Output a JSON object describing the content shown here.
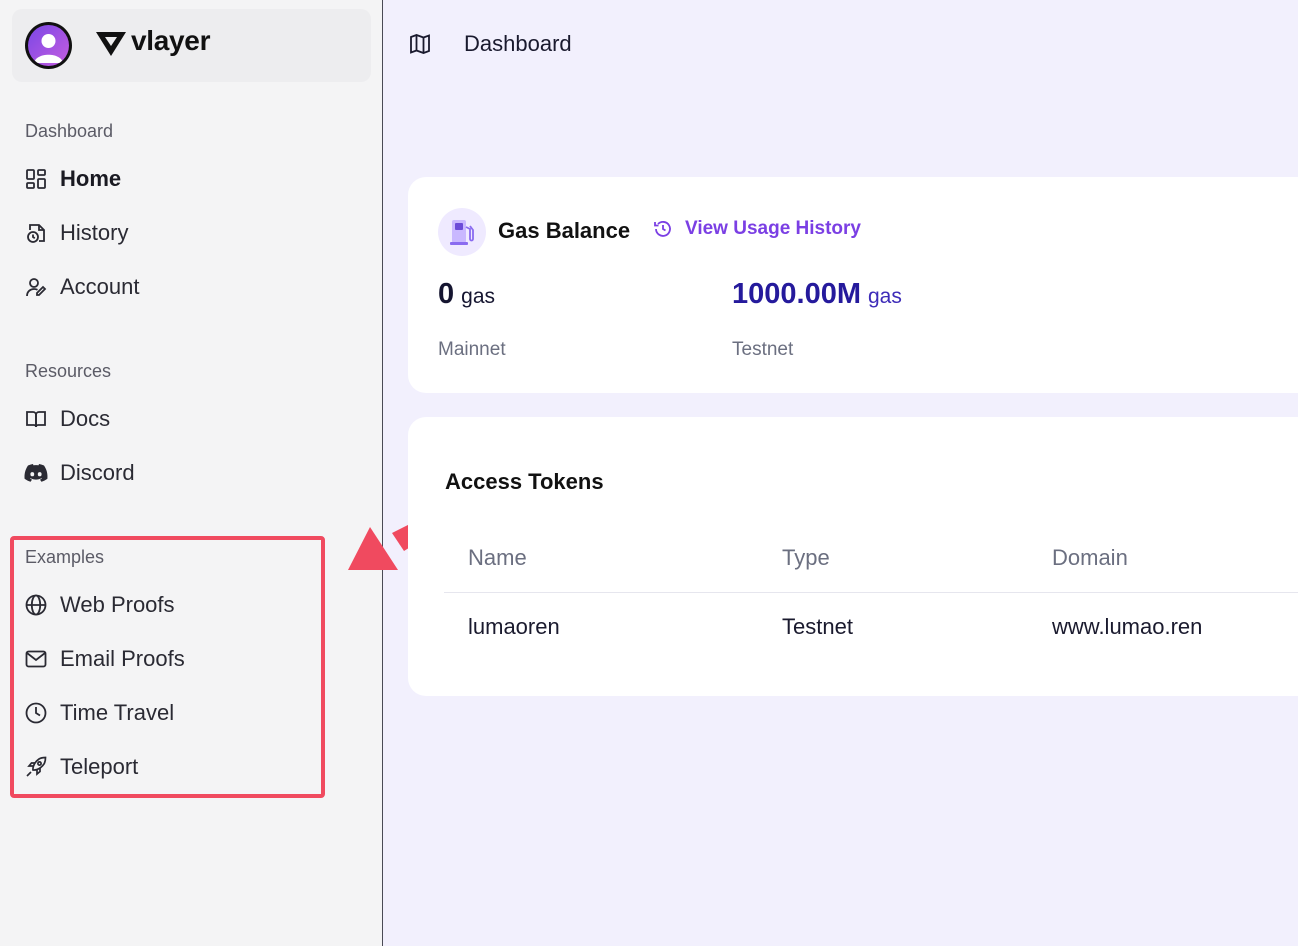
{
  "brand": {
    "name": "vlayer",
    "avatar_icon": "user-avatar-icon",
    "logo_icon": "vlayer-logo-icon"
  },
  "sidebar": {
    "sections": [
      {
        "label": "Dashboard",
        "items": [
          {
            "label": "Home",
            "icon": "grid-icon",
            "active": true
          },
          {
            "label": "History",
            "icon": "history-file-icon"
          },
          {
            "label": "Account",
            "icon": "user-key-icon"
          }
        ]
      },
      {
        "label": "Resources",
        "items": [
          {
            "label": "Docs",
            "icon": "book-icon"
          },
          {
            "label": "Discord",
            "icon": "discord-icon"
          }
        ]
      },
      {
        "label": "Examples",
        "items": [
          {
            "label": "Web Proofs",
            "icon": "globe-icon"
          },
          {
            "label": "Email Proofs",
            "icon": "mail-icon"
          },
          {
            "label": "Time Travel",
            "icon": "clock-icon"
          },
          {
            "label": "Teleport",
            "icon": "rocket-icon"
          }
        ]
      }
    ]
  },
  "topbar": {
    "title": "Dashboard",
    "icon": "map-icon"
  },
  "gas_balance": {
    "title": "Gas Balance",
    "history_link": "View Usage History",
    "mainnet": {
      "amount": "0",
      "unit": "gas",
      "label": "Mainnet"
    },
    "testnet": {
      "amount": "1000.00M",
      "unit": "gas",
      "label": "Testnet"
    }
  },
  "access_tokens": {
    "title": "Access Tokens",
    "columns": [
      "Name",
      "Type",
      "Domain"
    ],
    "rows": [
      [
        "lumaoren",
        "Testnet",
        "www.lumao.ren"
      ]
    ]
  },
  "colors": {
    "accent": "#7b3fe4",
    "testnet_amount": "#251a9c",
    "highlight": "#f04a5f",
    "background": "#f2f0fd"
  }
}
